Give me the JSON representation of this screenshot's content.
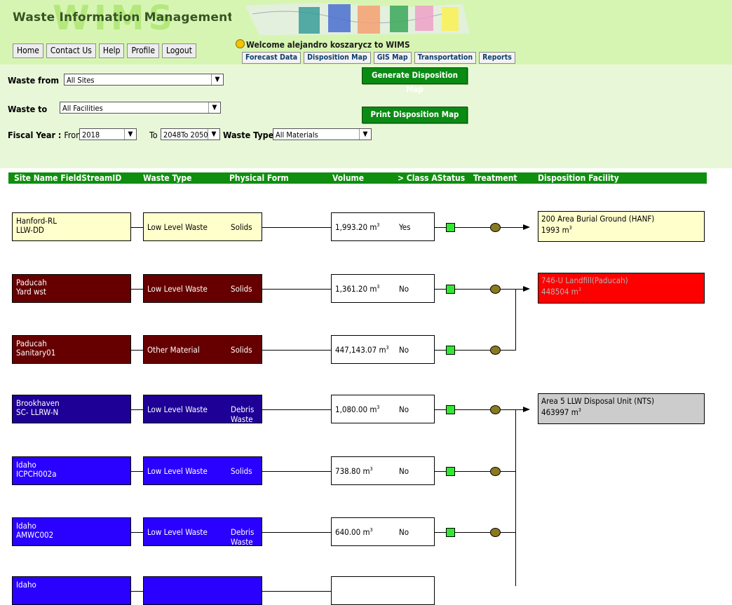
{
  "header": {
    "logo_letters": "WIMS",
    "app_title": "Waste Information Management System",
    "welcome_text": "Welcome alejandro koszarycz to WIMS",
    "nav_buttons": [
      "Home",
      "Contact Us",
      "Help",
      "Profile",
      "Logout"
    ],
    "tabs": [
      "Forecast Data",
      "Disposition Map",
      "GIS Map",
      "Transportation",
      "Reports"
    ]
  },
  "filters": {
    "waste_from_label": "Waste from",
    "waste_from_value": "All Sites",
    "waste_to_label": "Waste to",
    "waste_to_value": "All Facilities",
    "fiscal_year_label": "Fiscal Year :",
    "from_label": "From",
    "from_value": "2018",
    "to_label": "To",
    "to_value": "2048To 2050",
    "waste_type_label": "Waste Type:",
    "waste_type_value": "All Materials",
    "generate_button": "Generate Disposition Map",
    "print_button": "Print Disposition Map"
  },
  "columns": [
    "Site Name FieldStreamID",
    "Waste Type",
    "Physical Form",
    "Volume",
    "> Class AStatus",
    "Treatment",
    "Disposition Facility"
  ],
  "streams": [
    {
      "site": "Hanford-RL",
      "stream_id": "LLW-DD",
      "waste_type": "Low Level Waste",
      "physical_form": "Solids",
      "volume": "1,993.20 m",
      "unit_exp": "3",
      "class_a": "Yes",
      "color": "#ffffcc",
      "text_color": "#000000"
    },
    {
      "site": "Paducah",
      "stream_id": "Yard wst",
      "waste_type": "Low Level Waste",
      "physical_form": "Solids",
      "volume": "1,361.20 m",
      "unit_exp": "3",
      "class_a": "No",
      "color": "#660000",
      "text_color": "#ffffff"
    },
    {
      "site": "Paducah",
      "stream_id": "Sanitary01",
      "waste_type": "Other Material",
      "physical_form": "Solids",
      "volume": "447,143.07 m",
      "unit_exp": "3",
      "class_a": "No",
      "color": "#660000",
      "text_color": "#ffffff"
    },
    {
      "site": "Brookhaven",
      "stream_id": "SC- LLRW-N",
      "waste_type": "Low Level Waste",
      "physical_form": "Debris Waste",
      "volume": "1,080.00 m",
      "unit_exp": "3",
      "class_a": "No",
      "color": "#1e0096",
      "text_color": "#ffffff"
    },
    {
      "site": "Idaho",
      "stream_id": "ICPCH002a",
      "waste_type": "Low Level Waste",
      "physical_form": "Solids",
      "volume": "738.80 m",
      "unit_exp": "3",
      "class_a": "No",
      "color": "#2a00ff",
      "text_color": "#ffffff"
    },
    {
      "site": "Idaho",
      "stream_id": "AMWC002",
      "waste_type": "Low Level Waste",
      "physical_form": "Debris Waste",
      "volume": "640.00 m",
      "unit_exp": "3",
      "class_a": "No",
      "color": "#2a00ff",
      "text_color": "#ffffff"
    },
    {
      "site": "Idaho",
      "stream_id": "",
      "waste_type": "",
      "physical_form": "",
      "volume": "",
      "unit_exp": "",
      "class_a": "",
      "color": "#2a00ff",
      "text_color": "#ffffff"
    }
  ],
  "facilities": [
    {
      "name": "200 Area Burial Ground (HANF)",
      "volume": "1993 m",
      "unit_exp": "3",
      "color": "#ffffcc",
      "text_color": "#000000"
    },
    {
      "name": "746-U Landfill(Paducah)",
      "volume": "448504 m",
      "unit_exp": "3",
      "color": "#ff0000",
      "text_color": "#b3b3b3"
    },
    {
      "name": "Area 5 LLW Disposal Unit (NTS)",
      "volume": "463997 m",
      "unit_exp": "3",
      "color": "#cccccc",
      "text_color": "#000000"
    }
  ]
}
